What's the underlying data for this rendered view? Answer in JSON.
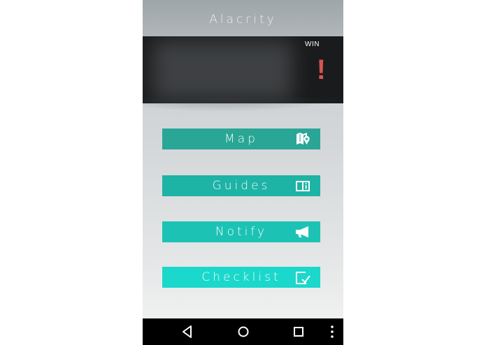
{
  "app": {
    "title": "Alacrity"
  },
  "banner": {
    "badge": "WIN",
    "alert_symbol": "!",
    "alert_color": "#d9534f"
  },
  "menu": [
    {
      "label": "Map",
      "icon": "map-pin-icon",
      "color": "#2aa696"
    },
    {
      "label": "Guides",
      "icon": "book-info-icon",
      "color": "#1db3a5"
    },
    {
      "label": "Notify",
      "icon": "megaphone-icon",
      "color": "#1cc3b5"
    },
    {
      "label": "Checklist",
      "icon": "checkbox-icon",
      "color": "#1ad8cb"
    }
  ],
  "navbar": {
    "items": [
      "back-icon",
      "home-icon",
      "recents-icon",
      "overflow-menu-icon"
    ]
  }
}
